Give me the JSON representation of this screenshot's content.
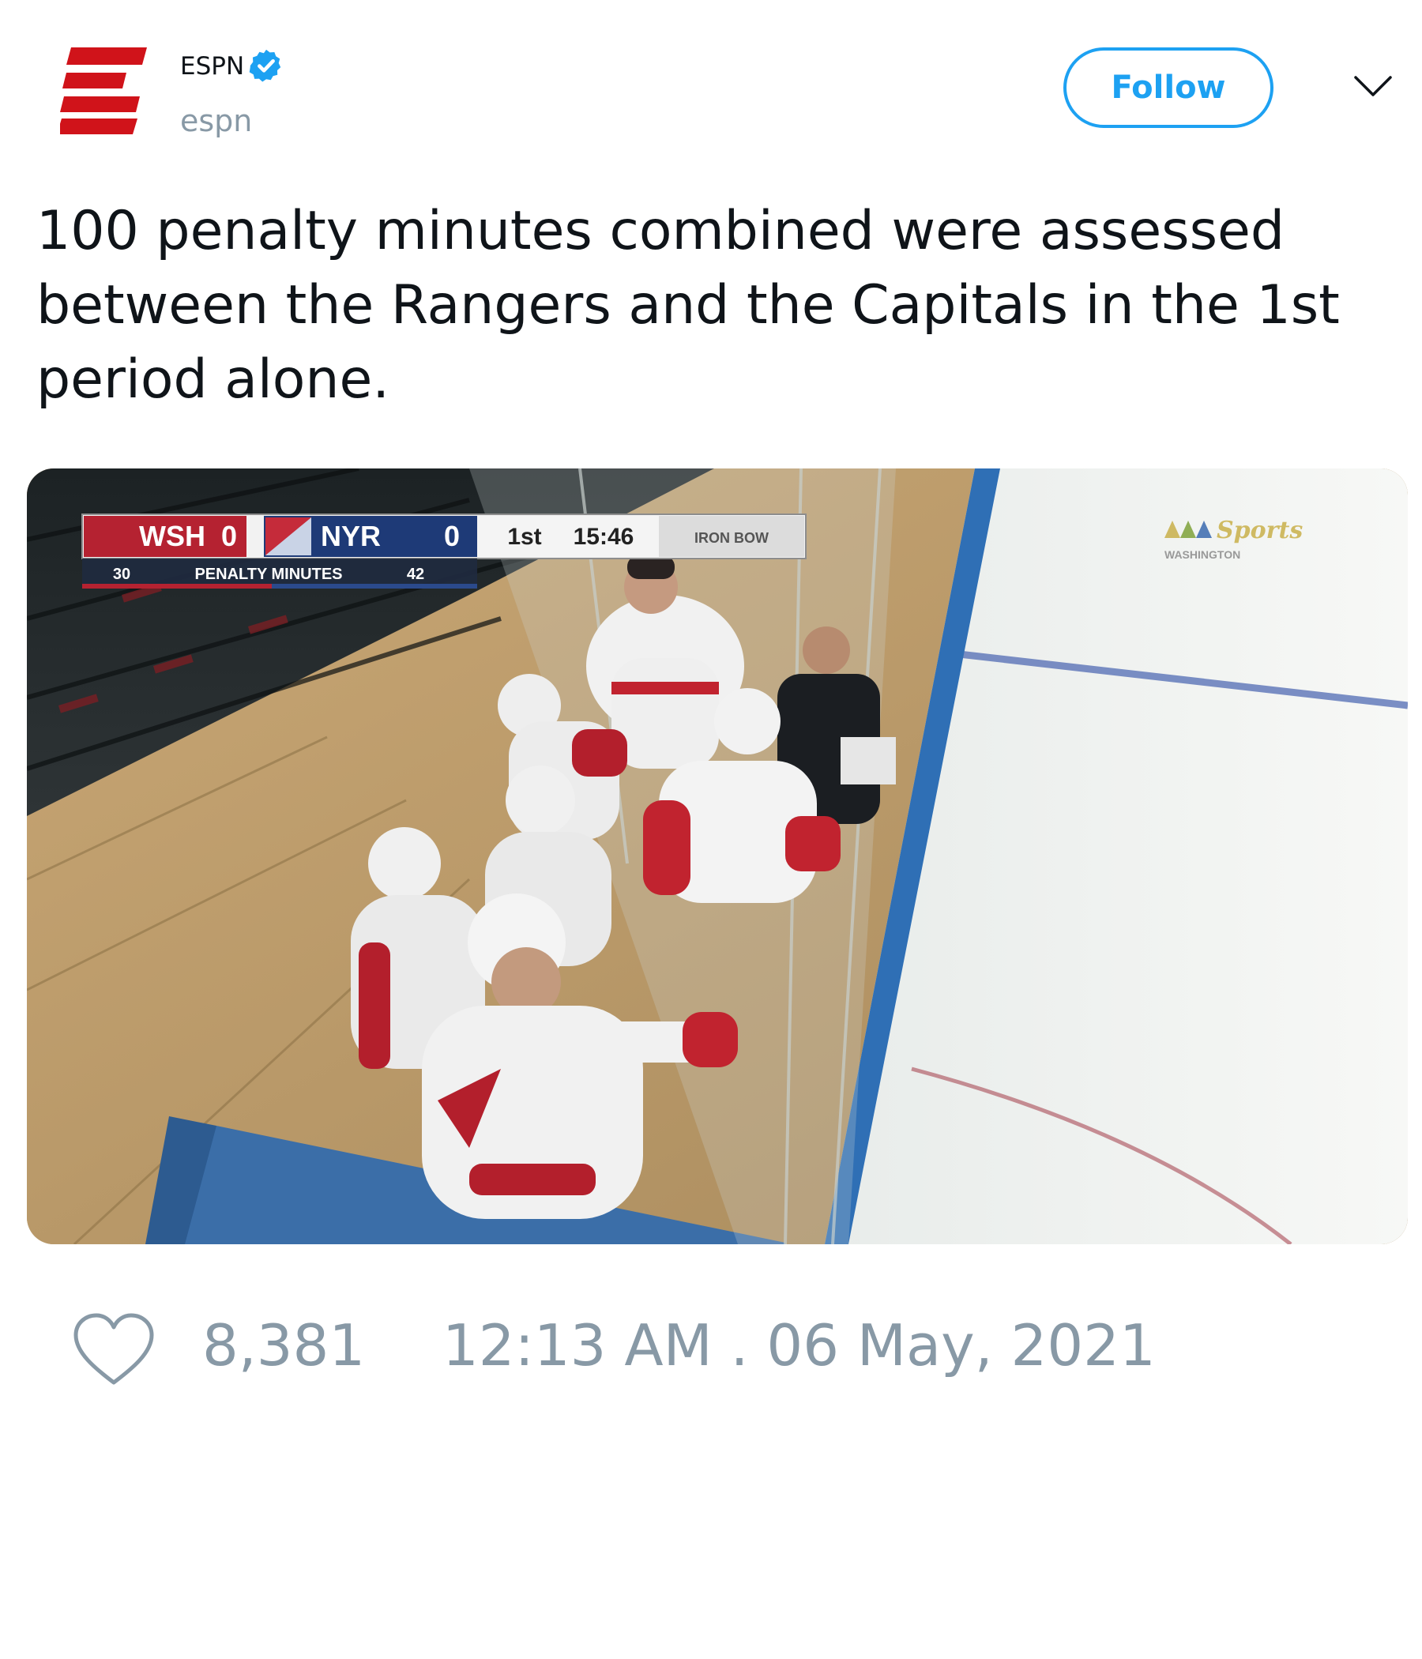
{
  "author": {
    "display_name": "ESPN",
    "handle": "espn",
    "verified": true,
    "avatar_icon": "espn-logo"
  },
  "actions": {
    "follow_label": "Follow",
    "menu_icon": "chevron-down-icon"
  },
  "tweet": {
    "text": "100 penalty minutes combined were assessed between the Rangers and the Capitals in the 1st period alone."
  },
  "media": {
    "scorebug": {
      "away_team": "WSH",
      "away_score": "0",
      "home_team": "NYR",
      "home_score": "0",
      "period": "1st",
      "clock": "15:46",
      "sponsor": "IRON BOW",
      "away_stat": "30",
      "stat_label": "PENALTY MINUTES",
      "home_stat": "42"
    },
    "broadcaster": {
      "name": "Sports",
      "region": "WASHINGTON"
    }
  },
  "footer": {
    "like_count": "8,381",
    "timestamp": "12:13 AM . 06 May, 2021"
  },
  "colors": {
    "follow_accent": "#1da1f2",
    "muted_text": "#8899a6",
    "espn_red": "#d0131a",
    "verified_blue": "#1da1f2"
  }
}
